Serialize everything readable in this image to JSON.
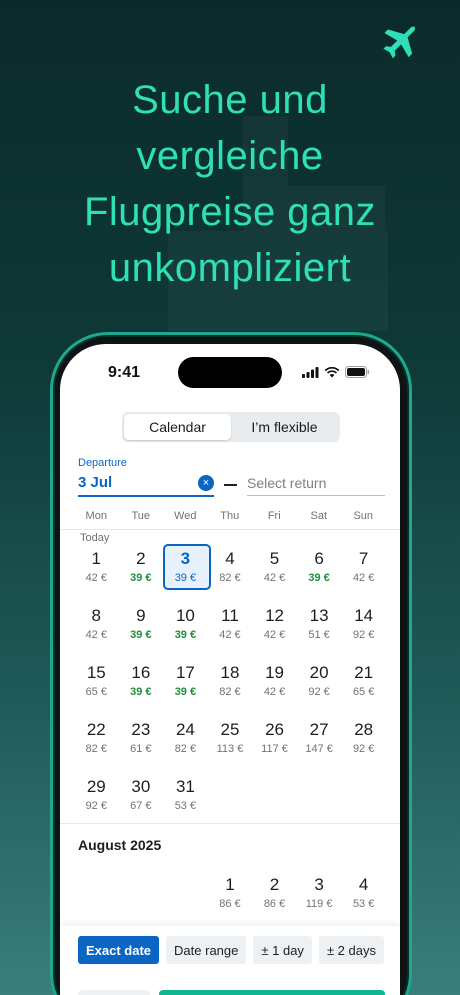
{
  "headline": [
    "Suche und",
    "vergleiche",
    "Flugpreise ganz",
    "unkompliziert"
  ],
  "status": {
    "time": "9:41"
  },
  "segmented": {
    "calendar": "Calendar",
    "flexible": "I’m flexible"
  },
  "departure": {
    "label": "Departure",
    "value": "3 Jul",
    "clear": "×"
  },
  "return_placeholder": "Select return",
  "weekdays": [
    "Mon",
    "Tue",
    "Wed",
    "Thu",
    "Fri",
    "Sat",
    "Sun"
  ],
  "today_label": "Today",
  "july": [
    [
      {
        "d": "1",
        "p": "42 €"
      },
      {
        "d": "2",
        "p": "39 €",
        "c": true
      },
      {
        "d": "3",
        "p": "39 €",
        "s": true
      },
      {
        "d": "4",
        "p": "82 €"
      },
      {
        "d": "5",
        "p": "42 €"
      },
      {
        "d": "6",
        "p": "39 €",
        "c": true
      },
      {
        "d": "7",
        "p": "42 €"
      }
    ],
    [
      {
        "d": "8",
        "p": "42 €"
      },
      {
        "d": "9",
        "p": "39 €",
        "c": true
      },
      {
        "d": "10",
        "p": "39 €",
        "c": true
      },
      {
        "d": "11",
        "p": "42 €"
      },
      {
        "d": "12",
        "p": "42 €"
      },
      {
        "d": "13",
        "p": "51 €"
      },
      {
        "d": "14",
        "p": "92 €"
      }
    ],
    [
      {
        "d": "15",
        "p": "65 €"
      },
      {
        "d": "16",
        "p": "39 €",
        "c": true
      },
      {
        "d": "17",
        "p": "39 €",
        "c": true
      },
      {
        "d": "18",
        "p": "82 €"
      },
      {
        "d": "19",
        "p": "42 €"
      },
      {
        "d": "20",
        "p": "92 €"
      },
      {
        "d": "21",
        "p": "65 €"
      }
    ],
    [
      {
        "d": "22",
        "p": "82 €"
      },
      {
        "d": "23",
        "p": "61 €"
      },
      {
        "d": "24",
        "p": "82 €"
      },
      {
        "d": "25",
        "p": "113 €"
      },
      {
        "d": "26",
        "p": "117 €"
      },
      {
        "d": "27",
        "p": "147 €"
      },
      {
        "d": "28",
        "p": "92 €"
      }
    ],
    [
      {
        "d": "29",
        "p": "92 €"
      },
      {
        "d": "30",
        "p": "67 €"
      },
      {
        "d": "31",
        "p": "53 €"
      }
    ]
  ],
  "august_title": "August 2025",
  "august": [
    [
      null,
      null,
      null,
      {
        "d": "1",
        "p": "86 €"
      },
      {
        "d": "2",
        "p": "86 €"
      },
      {
        "d": "3",
        "p": "119 €"
      },
      {
        "d": "4",
        "p": "53 €"
      }
    ]
  ],
  "chips": [
    "Exact date",
    "Date range",
    "±  1 day",
    "±  2 days"
  ],
  "colors": {
    "accent": "#0a66c2",
    "cheap": "#1f8f3a",
    "headline": "#2fe0b7",
    "cta": "#11b58f"
  }
}
